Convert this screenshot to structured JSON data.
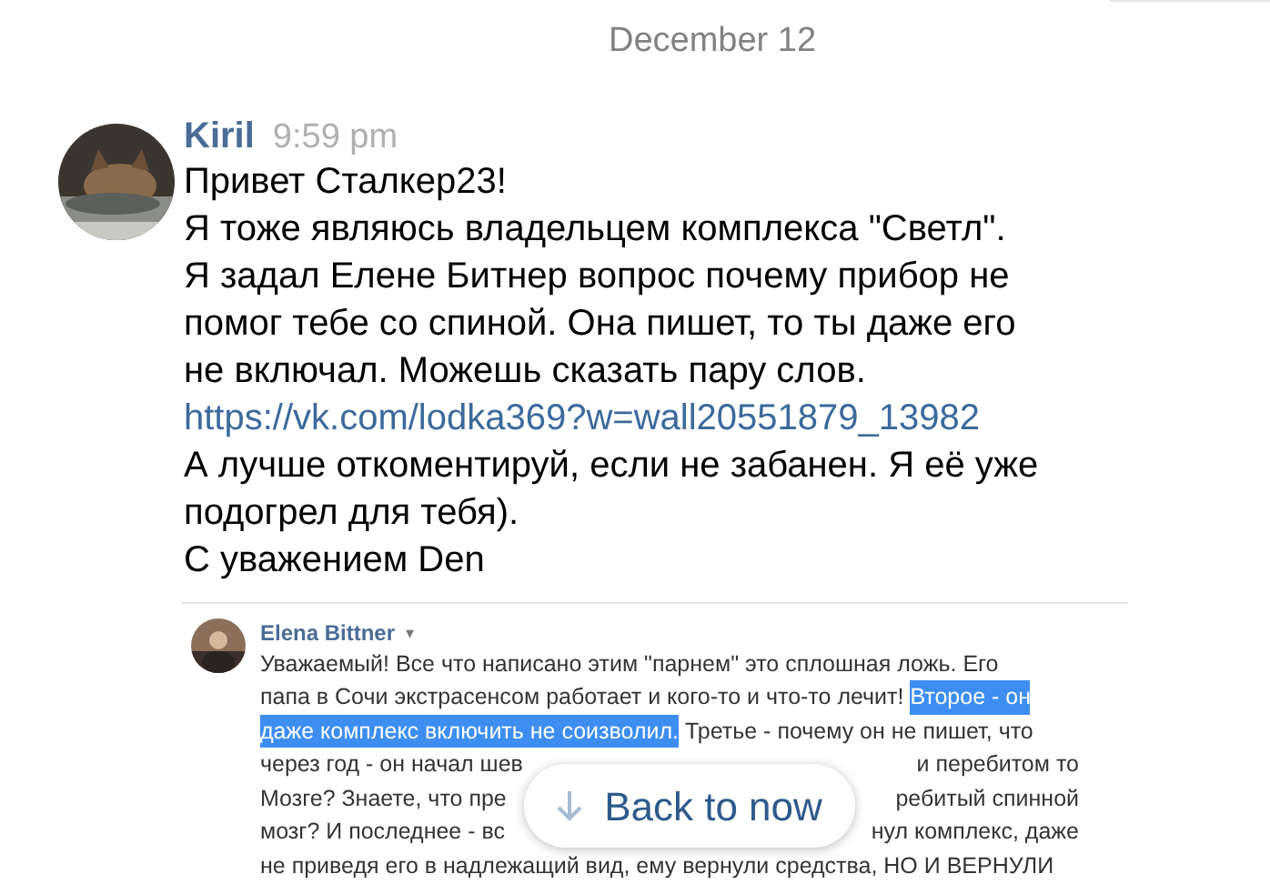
{
  "date_header": "December 12",
  "message": {
    "author": "Kiril",
    "time": "9:59 pm",
    "lines": [
      {
        "kind": "text",
        "text": "Привет Сталкер23!"
      },
      {
        "kind": "text",
        "text": "Я тоже являюсь владельцем комплекса \"Светл\"."
      },
      {
        "kind": "text",
        "text": "Я задал Елене Битнер вопрос почему прибор не"
      },
      {
        "kind": "text",
        "text": "помог тебе со спиной. Она пишет, то ты даже его"
      },
      {
        "kind": "text",
        "text": "не включал. Можешь сказать пару слов."
      },
      {
        "kind": "link",
        "text": "https://vk.com/lodka369?w=wall20551879_13982"
      },
      {
        "kind": "text",
        "text": "А лучше откоментируй, если не забанен. Я её уже"
      },
      {
        "kind": "text",
        "text": "подогрел для тебя)."
      },
      {
        "kind": "text",
        "text": "С уважением Den"
      }
    ],
    "attachment": {
      "author": "Elena Bittner",
      "menu_caret": "▾",
      "lines": [
        {
          "left": [
            {
              "text": "Уважаемый! Все что написано этим \"парнем\" это сплошная ложь. Его",
              "highlighted": false
            }
          ]
        },
        {
          "left": [
            {
              "text": "папа в Сочи экстрасенсом работает и кого-то и что-то лечит! ",
              "highlighted": false
            },
            {
              "text": "Второе - он",
              "highlighted": true
            }
          ]
        },
        {
          "left": [
            {
              "text": "даже комплекс включить не соизволил.",
              "highlighted": true
            },
            {
              "text": " Третье - почему он не пишет, что",
              "highlighted": false
            }
          ]
        },
        {
          "left": [
            {
              "text": "через год - он начал шев",
              "highlighted": false
            }
          ],
          "right": "и перебитом то"
        },
        {
          "left": [
            {
              "text": "Мозге? Знаете, что пре",
              "highlighted": false
            }
          ],
          "right": "ребитый спинной"
        },
        {
          "left": [
            {
              "text": "мозг? И последнее - вс",
              "highlighted": false
            }
          ],
          "right": "нул комплекс, даже"
        },
        {
          "left": [
            {
              "text": "не приведя его в надлежащий вид, ему вернули средства, НО И ВЕРНУЛИ",
              "highlighted": false
            }
          ]
        }
      ]
    }
  },
  "back_button": {
    "label": "Back to now"
  }
}
